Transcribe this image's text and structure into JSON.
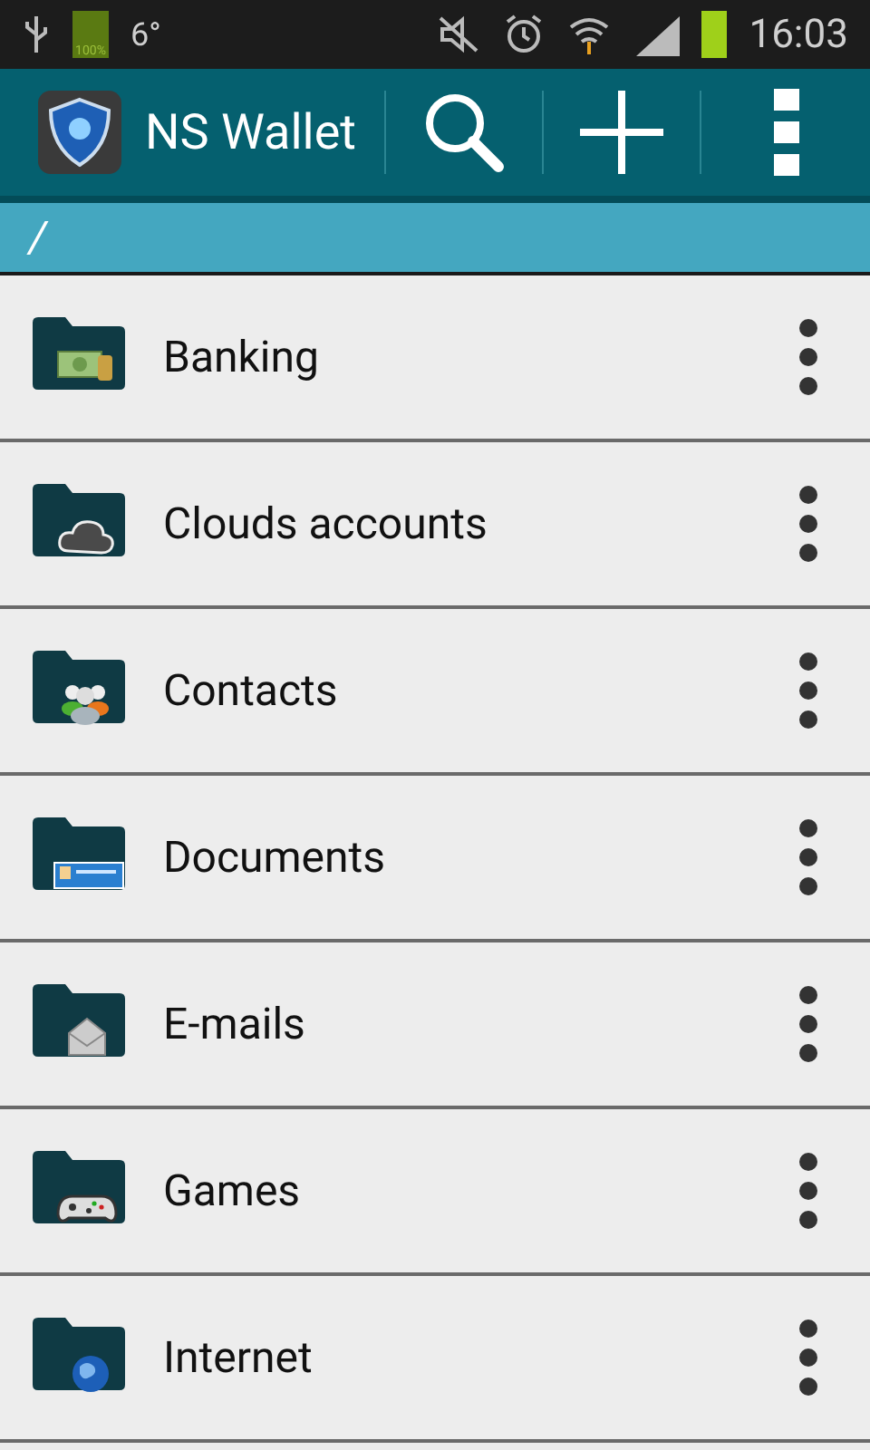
{
  "status_bar": {
    "battery_text": "100%",
    "temperature": "6°",
    "time": "16:03"
  },
  "app_bar": {
    "title": "NS Wallet"
  },
  "path": "/",
  "folders": [
    {
      "name": "Banking",
      "kind": "banking"
    },
    {
      "name": "Clouds accounts",
      "kind": "cloud"
    },
    {
      "name": "Contacts",
      "kind": "contacts"
    },
    {
      "name": "Documents",
      "kind": "documents"
    },
    {
      "name": "E-mails",
      "kind": "email"
    },
    {
      "name": "Games",
      "kind": "games"
    },
    {
      "name": "Internet",
      "kind": "internet"
    }
  ]
}
